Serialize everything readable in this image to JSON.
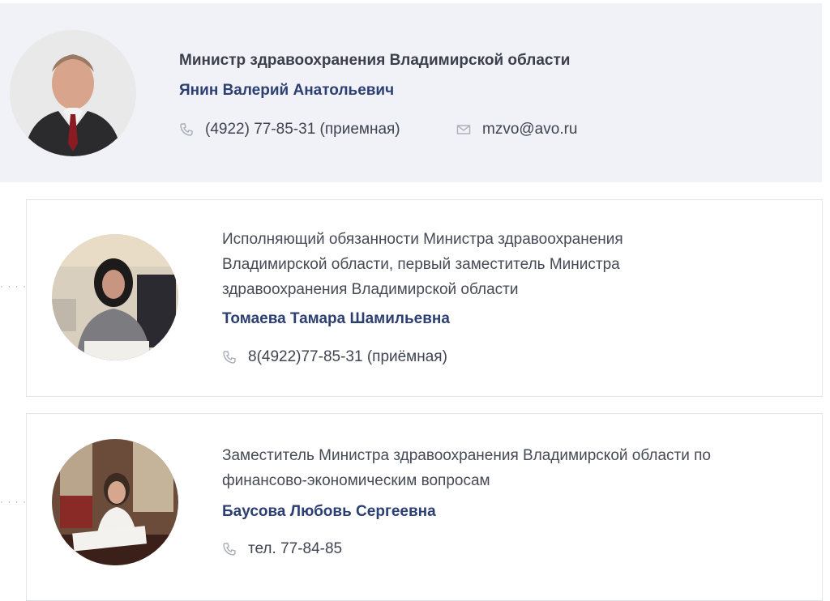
{
  "minister": {
    "title": "Министр здравоохранения Владимирской области",
    "name": "Янин Валерий Анатольевич",
    "phone": "(4922) 77-85-31 (приемная)",
    "email": "mzvo@avo.ru",
    "phone_icon": "phone-icon",
    "email_icon": "mail-icon"
  },
  "deputies": [
    {
      "position": "Исполняющий обязанности Министра здравоохранения Владимирской области, первый заместитель Министра здравоохранения Владимирской области",
      "name": "Томаева Тамара Шамильевна",
      "phone": "8(4922)77-85-31 (приёмная)"
    },
    {
      "position": "Заместитель Министра здравоохранения Владимирской области по финансово-экономическим вопросам",
      "name": "Баусова Любовь Сергеевна",
      "phone": "тел. 77-84-85"
    }
  ],
  "colors": {
    "name": "#2c3f73",
    "top_background": "#f1f2f7",
    "icon": "#a8adb8"
  }
}
